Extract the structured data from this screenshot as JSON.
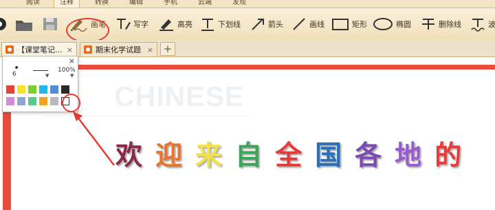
{
  "menu_tabs": [
    "阅读",
    "注释",
    "转换",
    "编辑",
    "手机",
    "云端",
    "发现"
  ],
  "menu_active": "注释",
  "toolbar": {
    "draw": "画笔",
    "write": "写字",
    "highlight": "高亮",
    "underline": "下划线",
    "arrow": "箭头",
    "line": "画线",
    "rect": "矩形",
    "ellipse": "椭圆",
    "strike": "删除线",
    "wave": "波"
  },
  "doc_tabs": [
    {
      "title": "【课堂笔记...",
      "close": "×"
    },
    {
      "title": "期末化学试题",
      "close": "×"
    }
  ],
  "new_tab": "+",
  "popup": {
    "close": "×",
    "size_value": "6",
    "opacity": "100%",
    "colors_row1": [
      "#e3443a",
      "#f5e52b",
      "#7dcf2a",
      "#23b5e3",
      "#4a8fd7",
      "#2a2a2a"
    ],
    "colors_row2": [
      "#d48ad6",
      "#8ea6d6",
      "#59c98a",
      "#f2a21f",
      "#b9b9b9",
      "#ffffff"
    ],
    "selected_color": "#ffffff"
  },
  "document": {
    "watermark": "CHINESE",
    "welcome_chars": [
      "欢",
      "迎",
      "来",
      "自",
      "全",
      "国",
      "各",
      "地",
      "的"
    ],
    "welcome_colors": [
      "#8a2a4a",
      "#e8742a",
      "#f2e24a",
      "#3aa657",
      "#e43b3b",
      "#2a6fb8",
      "#7a4cb2",
      "#9a5ad0",
      "#e83a3a"
    ]
  },
  "annotation_color": "#e33b2f"
}
